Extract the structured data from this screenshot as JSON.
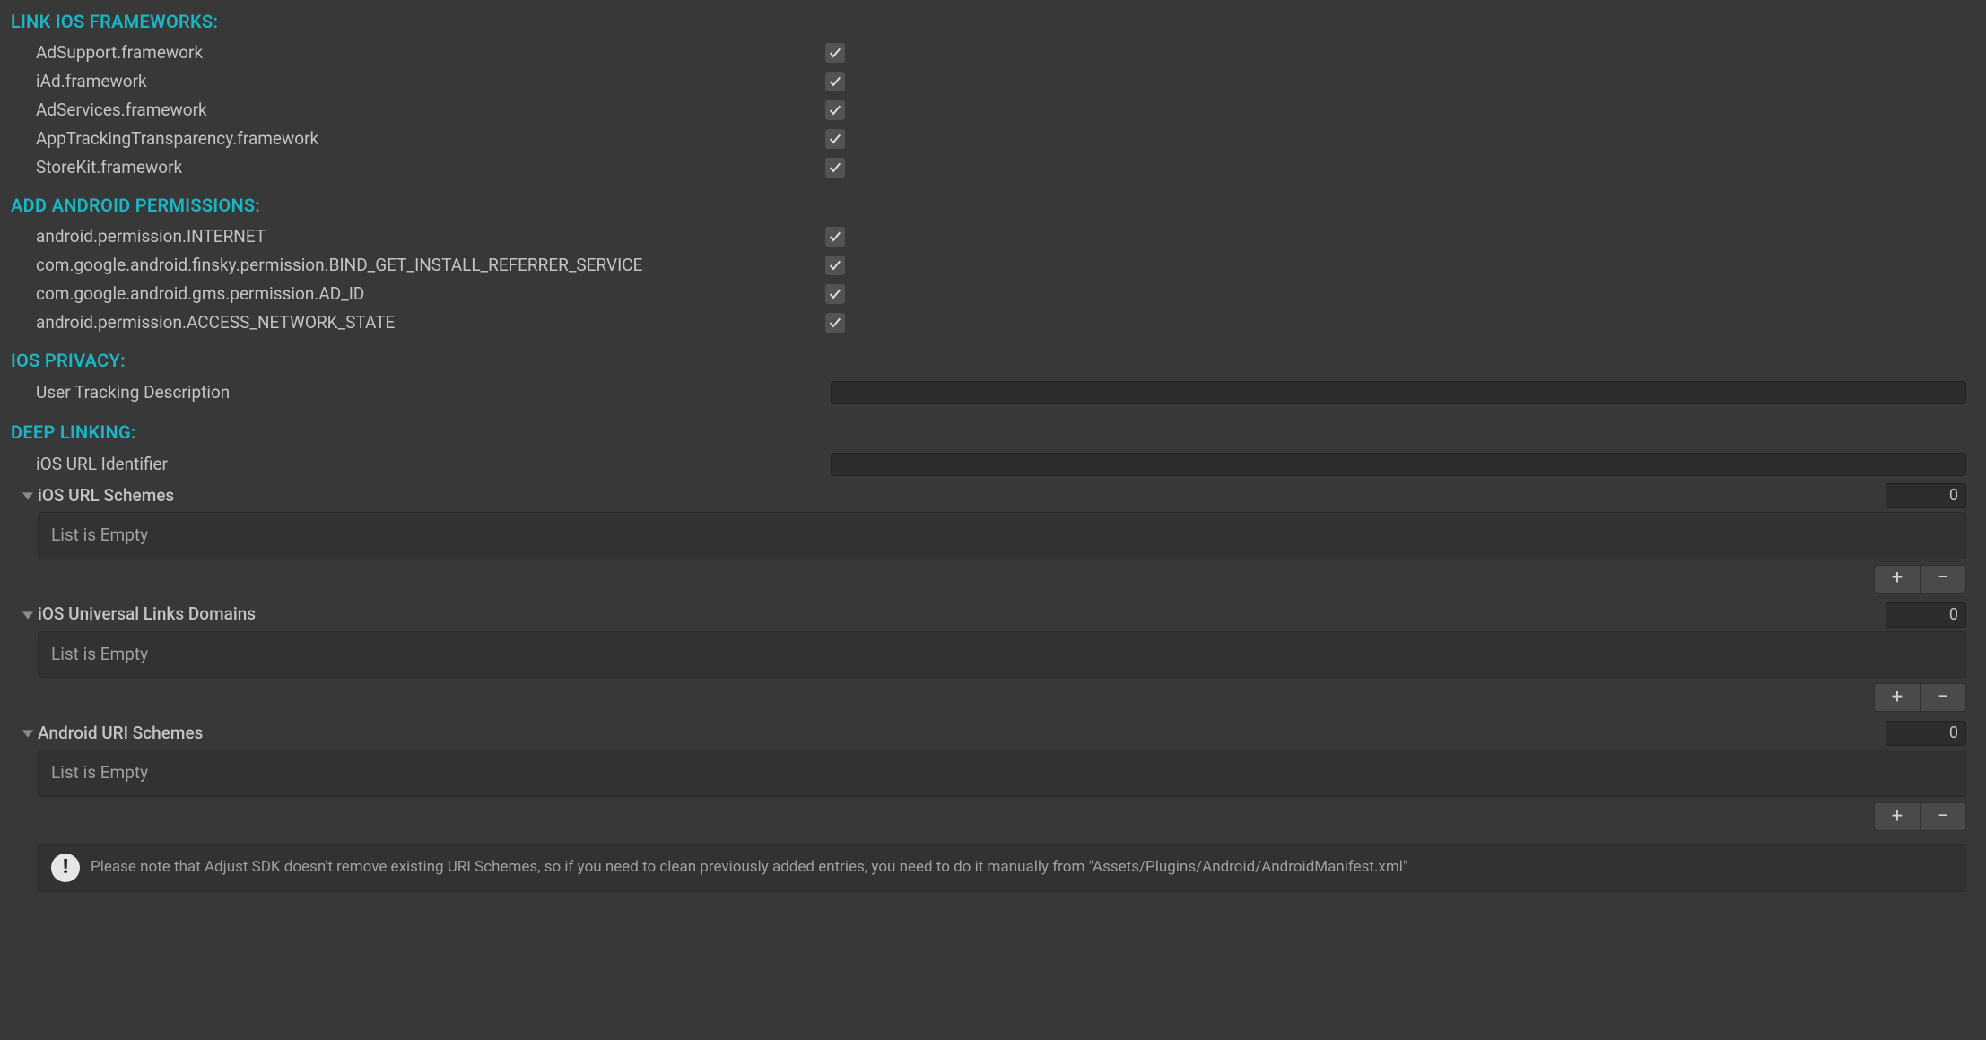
{
  "sections": {
    "ios_frameworks": {
      "header": "LINK IOS FRAMEWORKS:",
      "items": [
        {
          "label": "AdSupport.framework",
          "checked": true
        },
        {
          "label": "iAd.framework",
          "checked": true
        },
        {
          "label": "AdServices.framework",
          "checked": true
        },
        {
          "label": "AppTrackingTransparency.framework",
          "checked": true
        },
        {
          "label": "StoreKit.framework",
          "checked": true
        }
      ]
    },
    "android_permissions": {
      "header": "ADD ANDROID PERMISSIONS:",
      "items": [
        {
          "label": "android.permission.INTERNET",
          "checked": true
        },
        {
          "label": "com.google.android.finsky.permission.BIND_GET_INSTALL_REFERRER_SERVICE",
          "checked": true
        },
        {
          "label": "com.google.android.gms.permission.AD_ID",
          "checked": true
        },
        {
          "label": "android.permission.ACCESS_NETWORK_STATE",
          "checked": true
        }
      ]
    },
    "ios_privacy": {
      "header": "IOS PRIVACY:",
      "user_tracking_label": "User Tracking Description",
      "user_tracking_value": ""
    },
    "deep_linking": {
      "header": "DEEP LINKING:",
      "ios_url_identifier_label": "iOS URL Identifier",
      "ios_url_identifier_value": "",
      "lists": {
        "ios_url_schemes": {
          "label": "iOS URL Schemes",
          "count": "0",
          "empty_text": "List is Empty"
        },
        "ios_universal_links": {
          "label": "iOS Universal Links Domains",
          "count": "0",
          "empty_text": "List is Empty"
        },
        "android_uri_schemes": {
          "label": "Android URI Schemes",
          "count": "0",
          "empty_text": "List is Empty"
        }
      },
      "note": "Please note that Adjust SDK doesn't remove existing URI Schemes, so if you need to clean previously added entries, you need to do it manually from \"Assets/Plugins/Android/AndroidManifest.xml\""
    }
  },
  "buttons": {
    "plus_glyph": "+",
    "minus_glyph": "−"
  },
  "icons": {
    "info_glyph": "!"
  }
}
